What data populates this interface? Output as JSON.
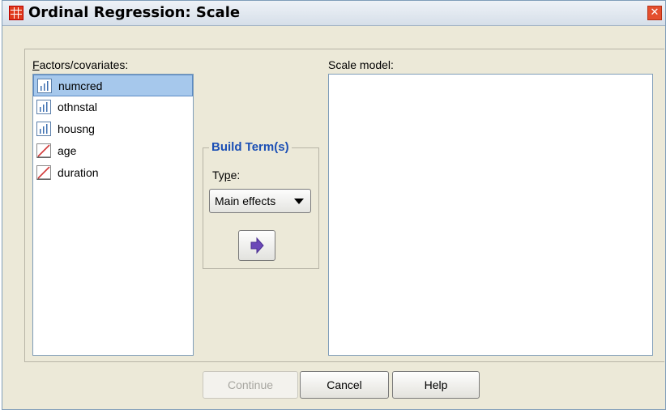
{
  "window": {
    "title": "Ordinal Regression: Scale"
  },
  "factors": {
    "label": "Factors/covariates:",
    "label_underline": "F",
    "label_rest": "actors/covariates:",
    "items": [
      {
        "label": "numcred",
        "icon": "ordinal-variable-icon",
        "selected": true
      },
      {
        "label": "othnstal",
        "icon": "ordinal-variable-icon",
        "selected": false
      },
      {
        "label": "housng",
        "icon": "ordinal-variable-icon",
        "selected": false
      },
      {
        "label": "age",
        "icon": "scale-variable-icon",
        "selected": false
      },
      {
        "label": "duration",
        "icon": "scale-variable-icon",
        "selected": false
      }
    ]
  },
  "build_terms": {
    "legend": "Build Term(s)",
    "type_label_pre": "Ty",
    "type_label_ul": "p",
    "type_label_post": "e:",
    "type_value": "Main effects",
    "move_icon": "right-arrow-icon"
  },
  "scale_model": {
    "label": "Scale model:"
  },
  "buttons": {
    "continue": "Continue",
    "cancel": "Cancel",
    "help": "Help"
  },
  "colors": {
    "accent": "#1b4fb5",
    "selection": "#a6c8ec"
  }
}
